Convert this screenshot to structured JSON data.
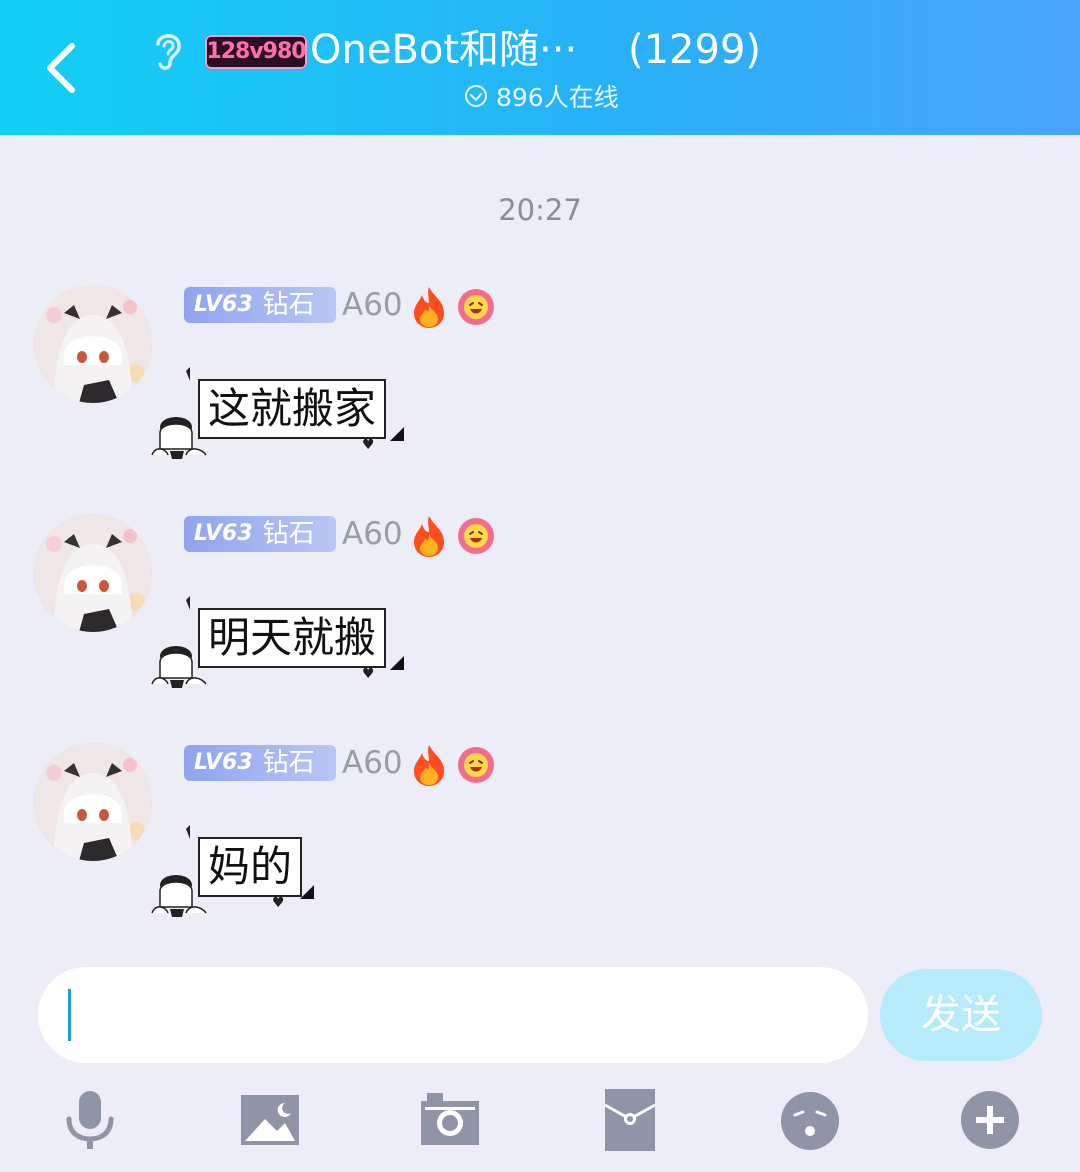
{
  "header": {
    "title": "OneBot和随···",
    "member_count": "(1299)",
    "group_tag": "128v980",
    "online_text": "896人在线"
  },
  "chat": {
    "timestamp": "20:27",
    "messages": [
      {
        "level": "LV63",
        "rank": "钻石",
        "name": "A60",
        "text": "这就搬家"
      },
      {
        "level": "LV63",
        "rank": "钻石",
        "name": "A60",
        "text": "明天就搬"
      },
      {
        "level": "LV63",
        "rank": "钻石",
        "name": "A60",
        "text": "妈的"
      }
    ]
  },
  "composer": {
    "input_value": "",
    "send_label": "发送"
  },
  "toolbar": {
    "icons": [
      "microphone-icon",
      "image-icon",
      "camera-icon",
      "red-envelope-icon",
      "emoji-icon",
      "plus-icon"
    ]
  },
  "colors": {
    "header_start": "#12d0f5",
    "header_end": "#4aa4f9",
    "background": "#ecedf6",
    "send_button": "#b6ebfb",
    "badge": "#8ea4ef",
    "icon_gray": "#8f94a6"
  }
}
